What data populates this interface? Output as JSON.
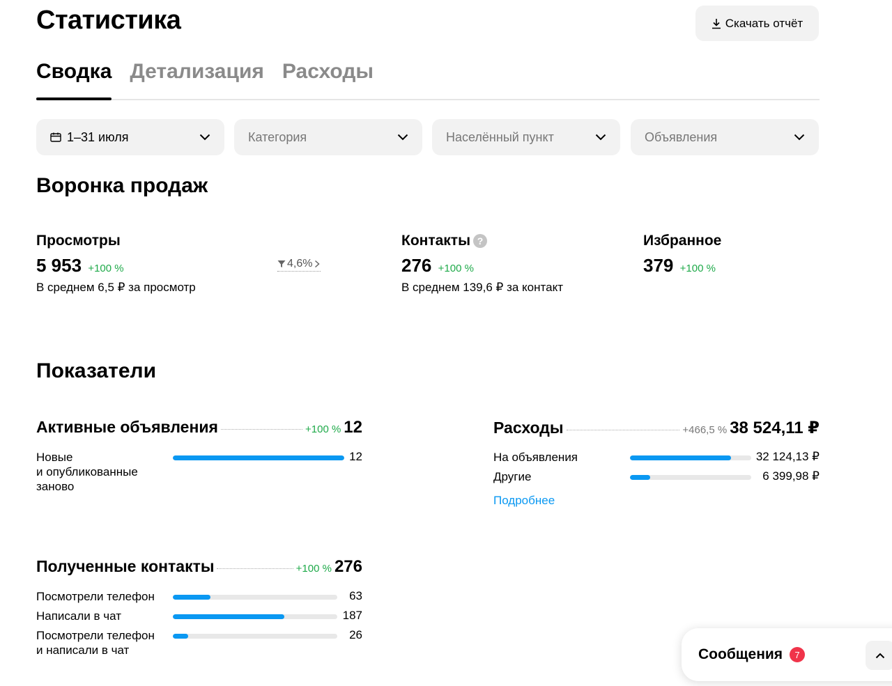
{
  "header": {
    "title": "Статистика",
    "download_label": "Скачать отчёт"
  },
  "tabs": [
    {
      "label": "Сводка",
      "active": true
    },
    {
      "label": "Детализация",
      "active": false
    },
    {
      "label": "Расходы",
      "active": false
    }
  ],
  "filters": {
    "date": "1–31 июля",
    "category_placeholder": "Категория",
    "city_placeholder": "Населённый пункт",
    "ads_placeholder": "Объявления"
  },
  "funnel": {
    "title": "Воронка продаж",
    "views": {
      "label": "Просмотры",
      "value": "5 953",
      "delta": "+100 %",
      "note": "В среднем 6,5 ₽ за просмотр",
      "conversion": "4,6%"
    },
    "contacts": {
      "label": "Контакты",
      "help": "?",
      "value": "276",
      "delta": "+100 %",
      "note": "В среднем 139,6 ₽ за контакт"
    },
    "favorites": {
      "label": "Избранное",
      "value": "379",
      "delta": "+100 %"
    }
  },
  "indicators": {
    "title": "Показатели",
    "active_ads": {
      "label": "Активные объявления",
      "delta": "+100 %",
      "value": "12",
      "rows": [
        {
          "label_lines": [
            "Новые",
            "и опубликованные",
            "заново"
          ],
          "value": "12",
          "fraction": 1.0
        }
      ]
    },
    "expenses": {
      "label": "Расходы",
      "delta": "+466,5 %",
      "value": "38 524,11 ₽",
      "rows": [
        {
          "label": "На объявления",
          "value": "32 124,13 ₽",
          "fraction": 0.834
        },
        {
          "label": "Другие",
          "value": "6 399,98 ₽",
          "fraction": 0.166
        }
      ],
      "more_link": "Подробнее"
    },
    "contacts": {
      "label": "Полученные контакты",
      "delta": "+100 %",
      "value": "276",
      "rows": [
        {
          "label_lines": [
            "Посмотрели телефон"
          ],
          "value": "63",
          "fraction": 0.228
        },
        {
          "label_lines": [
            "Написали в чат"
          ],
          "value": "187",
          "fraction": 0.678
        },
        {
          "label_lines": [
            "Посмотрели телефон",
            "и написали в чат"
          ],
          "value": "26",
          "fraction": 0.094
        }
      ]
    }
  },
  "messages": {
    "label": "Сообщения",
    "badge": "7"
  },
  "colors": {
    "accent": "#0a98f2",
    "positive": "#1faa4a",
    "badge": "#f0344a"
  },
  "icons": [
    "download-icon",
    "calendar-icon",
    "chevron-down-icon",
    "funnel-icon",
    "chevron-right-icon",
    "help-icon",
    "chevron-up-icon"
  ]
}
